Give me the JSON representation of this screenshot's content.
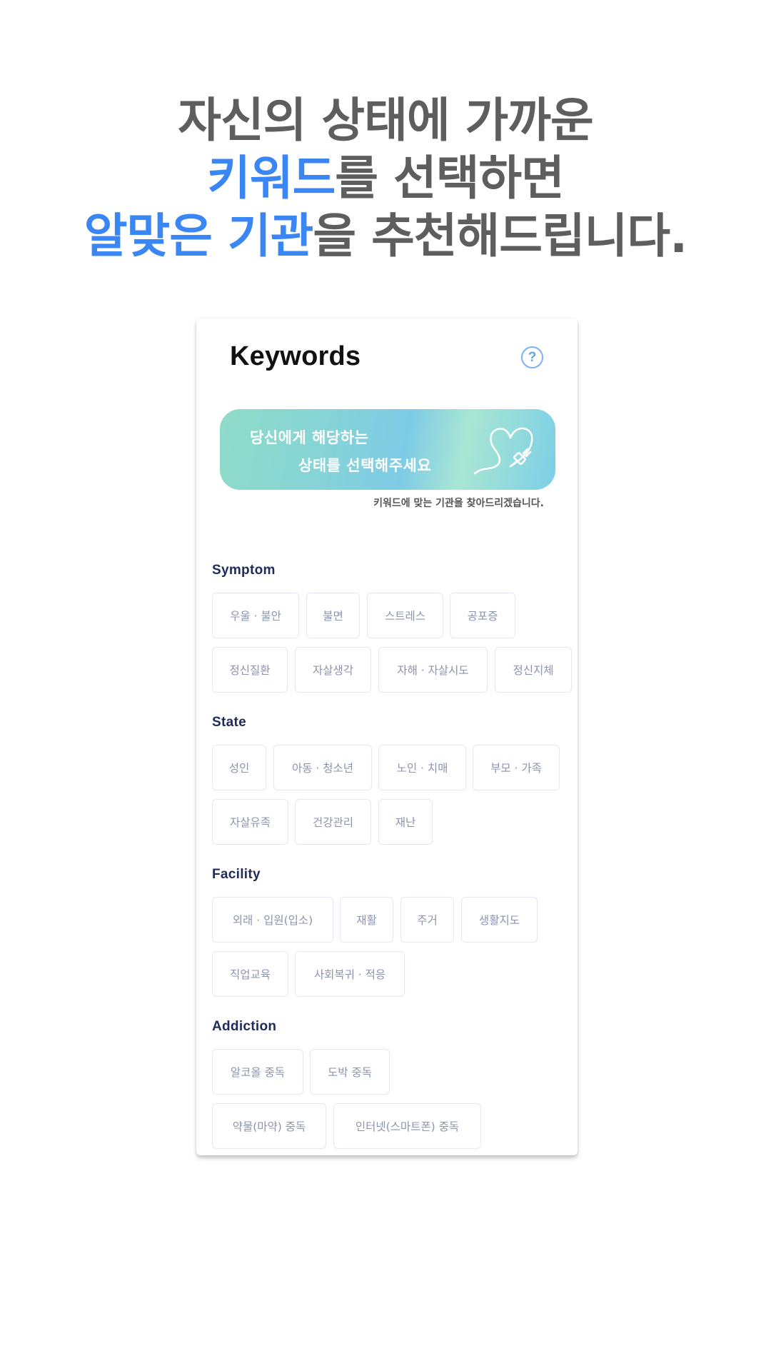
{
  "headline": {
    "line1": "자신의 상태에 가까운",
    "line2_highlight": "키워드",
    "line2_rest": "를 선택하면",
    "line3_highlight": "알맞은 기관",
    "line3_rest": "을 추천해드립니다."
  },
  "card": {
    "title": "Keywords",
    "help_symbol": "?",
    "banner": {
      "line1": "당신에게 해당하는",
      "line2": "상태를 선택해주세요"
    },
    "caption": "키워드에 맞는 기관을 찾아드리겠습니다."
  },
  "sections": {
    "symptom": {
      "title": "Symptom",
      "chips": [
        "우울 · 불안",
        "불면",
        "스트레스",
        "공포증",
        "정신질환",
        "자살생각",
        "자해 · 자살시도",
        "정신지체"
      ]
    },
    "state": {
      "title": "State",
      "chips": [
        "성인",
        "아동 · 청소년",
        "노인 · 치매",
        "부모 · 가족",
        "자살유족",
        "건강관리",
        "재난"
      ]
    },
    "facility": {
      "title": "Facility",
      "chips": [
        "외래 · 입원(입소)",
        "재활",
        "주거",
        "생활지도",
        "직업교육",
        "사회복귀 · 적응"
      ]
    },
    "addiction": {
      "title": "Addiction",
      "chips": [
        "알코올 중독",
        "도박 중독",
        "약물(마약) 중독",
        "인터넷(스마트폰) 중독"
      ]
    }
  },
  "colors": {
    "headline_text": "#5e5e5e",
    "highlight": "#3b86f5",
    "section_title": "#1f2b5a",
    "chip_text": "#8a94ad",
    "chip_border": "#e3e8f3"
  },
  "icons": {
    "help": "question-circle-icon",
    "banner_art": "heart-plug-icon"
  }
}
